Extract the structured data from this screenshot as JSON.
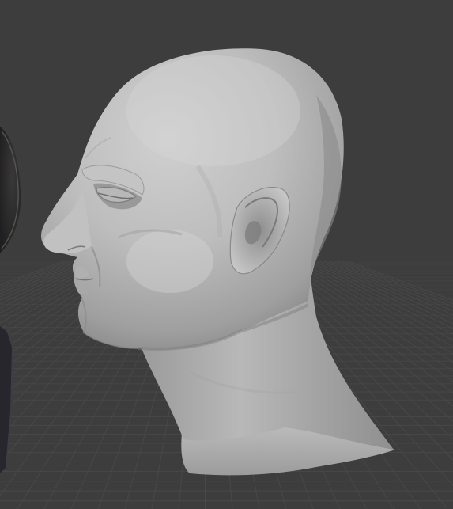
{
  "viewport": {
    "background": "#3d3d3d",
    "grid_color": "#4a4a4a",
    "grid_major_color": "#555555",
    "shows_grid_floor": true
  },
  "scene": {
    "objects": [
      {
        "name": "head-sculpt",
        "shading": "solid",
        "base_color": "#b4b4b4",
        "selected": false
      },
      {
        "name": "adjacent-object-left",
        "shading": "solid",
        "base_color": "#2b2b2d",
        "partially_visible": true
      },
      {
        "name": "adjacent-object-left-lower",
        "shading": "solid",
        "base_color": "#26262c",
        "partially_visible": true
      }
    ]
  }
}
